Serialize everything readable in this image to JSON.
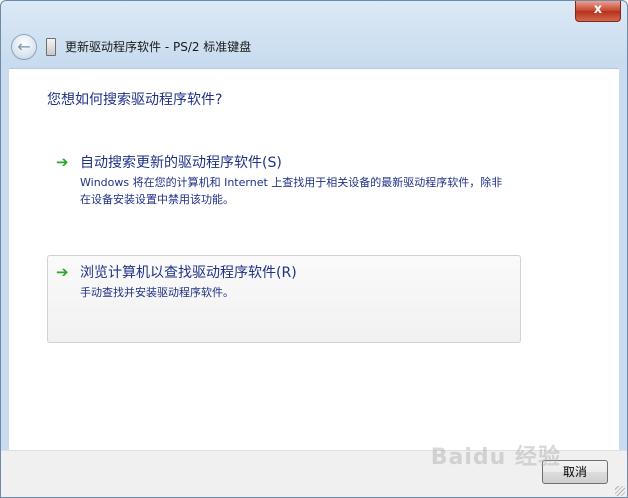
{
  "window": {
    "title": "更新驱动程序软件 - PS/2 标准键盘",
    "close_label": "x",
    "back_label": "←"
  },
  "heading": "您想如何搜索驱动程序软件?",
  "options": [
    {
      "title": "自动搜索更新的驱动程序软件(S)",
      "description": "Windows 将在您的计算机和 Internet 上查找用于相关设备的最新驱动程序软件，除非在设备安装设置中禁用该功能。",
      "arrow": "➔"
    },
    {
      "title": "浏览计算机以查找驱动程序软件(R)",
      "description": "手动查找并安装驱动程序软件。",
      "arrow": "➔"
    }
  ],
  "footer": {
    "cancel_label": "取消"
  },
  "watermark": "Baidu 经验",
  "colors": {
    "link_blue": "#1e3287",
    "arrow_green": "#2aa82a"
  }
}
